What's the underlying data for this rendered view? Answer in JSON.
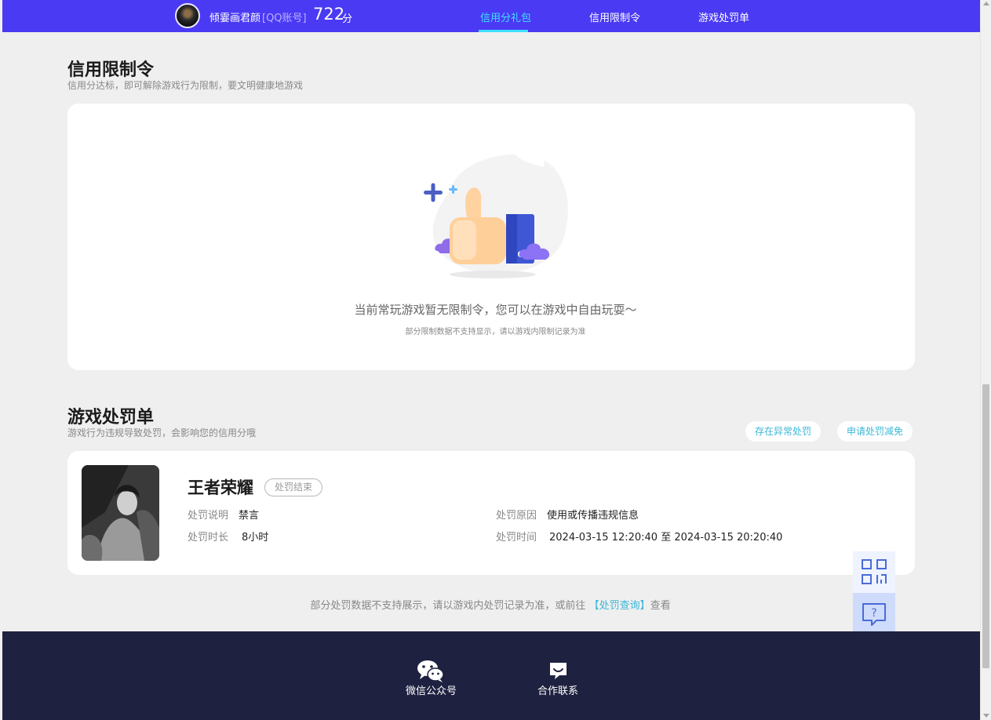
{
  "header": {
    "username": "倾霎画君颜",
    "account_type": "[QQ账号]",
    "score": "722",
    "score_unit": "分",
    "nav": [
      {
        "label": "信用分礼包",
        "active": true
      },
      {
        "label": "信用限制令",
        "active": false
      },
      {
        "label": "游戏处罚单",
        "active": false
      }
    ]
  },
  "restriction": {
    "title": "信用限制令",
    "subtitle": "信用分达标，即可解除游戏行为限制，要文明健康地游戏",
    "empty_message": "当前常玩游戏暂无限制令，您可以在游戏中自由玩耍～",
    "empty_note": "部分限制数据不支持显示，请以游戏内限制记录为准"
  },
  "penalty": {
    "title": "游戏处罚单",
    "subtitle": "游戏行为违规导致处罚，会影响您的信用分哦",
    "buttons": {
      "abnormal": "存在异常处罚",
      "reduce": "申请处罚减免"
    },
    "record": {
      "game": "王者荣耀",
      "status": "处罚结束",
      "desc_label": "处罚说明",
      "desc_value": "禁言",
      "duration_label": "处罚时长",
      "duration_value": "8小时",
      "reason_label": "处罚原因",
      "reason_value": "使用或传播违规信息",
      "time_label": "处罚时间",
      "time_value": "2024-03-15 12:20:40 至 2024-03-15 20:20:40"
    },
    "footnote_before": "部分处罚数据不支持展示，请以游戏内处罚记录为准，或前往",
    "footnote_link": "【处罚查询】",
    "footnote_after": "查看"
  },
  "footer": {
    "wechat_label": "微信公众号",
    "contact_label": "合作联系"
  },
  "icons": {
    "qr": "qr-code-icon",
    "help": "help-chat-icon",
    "wechat": "wechat-icon",
    "contact": "chat-bubble-icon"
  },
  "colors": {
    "header_bg": "#4a3af4",
    "nav_active": "#3fe0ff",
    "footer_bg": "#1f2140",
    "link": "#3bb8d8"
  }
}
